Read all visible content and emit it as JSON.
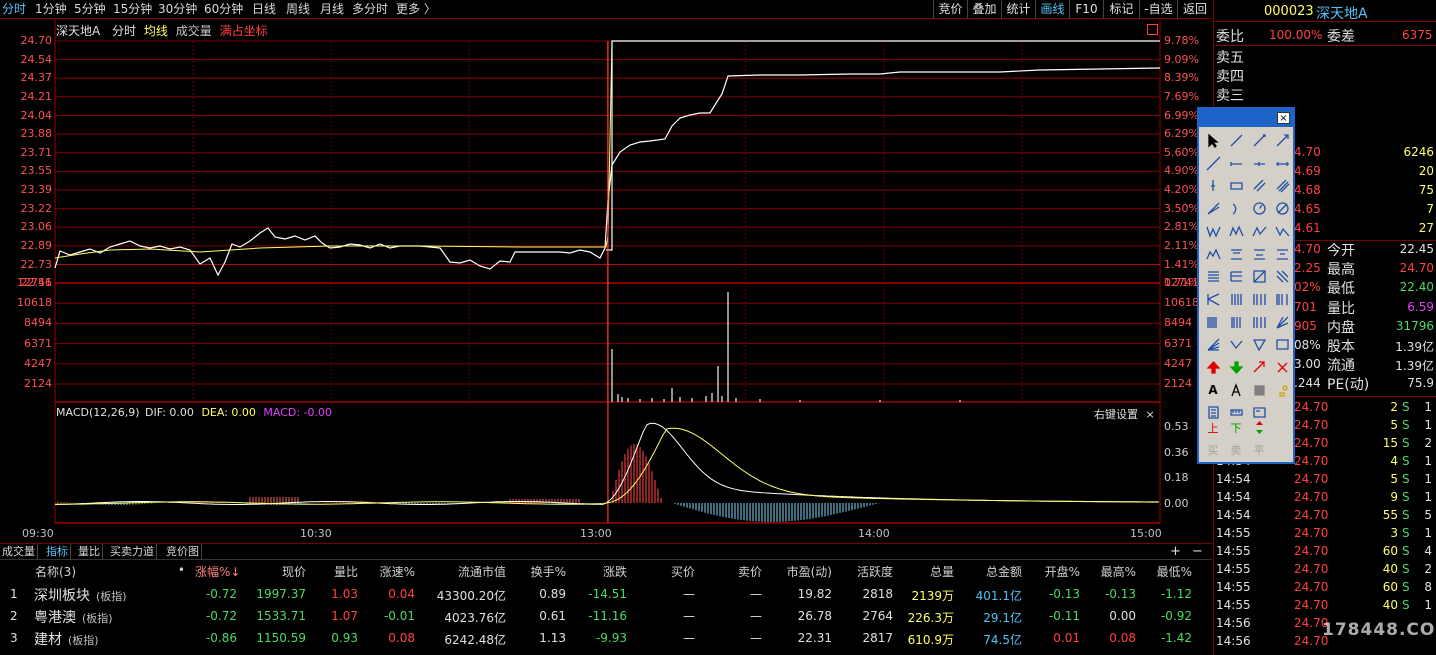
{
  "periods": [
    "分时",
    "1分钟",
    "5分钟",
    "15分钟",
    "30分钟",
    "60分钟",
    "日线",
    "周线",
    "月线",
    "多分时",
    "更多 〉"
  ],
  "active_period": 0,
  "right_buttons": [
    "竞价",
    "叠加",
    "统计",
    "画线",
    "F10",
    "标记",
    "-自选",
    "返回"
  ],
  "active_right_button": 3,
  "stock": {
    "code": "000023",
    "name": "深天地A"
  },
  "chart_info": {
    "name": "深天地A",
    "mode": "分时",
    "avg": "均线",
    "vol": "成交量",
    "fullscale": "满占坐标"
  },
  "price_axis": [
    "24.70",
    "24.54",
    "24.37",
    "24.21",
    "24.04",
    "23.88",
    "23.71",
    "23.55",
    "23.39",
    "23.22",
    "23.06",
    "22.89",
    "22.73",
    "22.56"
  ],
  "pct_axis": [
    "9.78%",
    "9.09%",
    "8.39%",
    "7.69%",
    "6.99%",
    "6.29%",
    "5.60%",
    "4.90%",
    "4.20%",
    "3.50%",
    "2.81%",
    "2.11%",
    "1.41%",
    "0.71%"
  ],
  "vol_axis": [
    "12741",
    "10618",
    "8494",
    "6371",
    "4247",
    "2124"
  ],
  "macd": {
    "label": "MACD(12,26,9)",
    "dif": "DIF: 0.00",
    "dea": "DEA: 0.00",
    "macd": "MACD: -0.00",
    "settings": "右键设置",
    "close": "×",
    "axis": [
      "0.53",
      "0.36",
      "0.18",
      "0.00"
    ]
  },
  "time_axis": [
    "09:30",
    "10:30",
    "13:00",
    "14:00",
    "15:00"
  ],
  "bottom_tabs": [
    "成交量",
    "指标",
    "量比",
    "买卖力道",
    "竞价图"
  ],
  "active_bottom_tab": 1,
  "bottom_controls": {
    "plus": "+",
    "minus": "−",
    "close": "×"
  },
  "table": {
    "headers": [
      "名称(3)",
      "•",
      "涨幅%↓",
      "现价",
      "量比",
      "涨速%",
      "流通市值",
      "换手%",
      "涨跌",
      "买价",
      "卖价",
      "市盈(动)",
      "活跃度",
      "总量",
      "总金额",
      "开盘%",
      "最高%",
      "最低%"
    ],
    "rows": [
      {
        "idx": "1",
        "name": "深圳板块",
        "tag": "(板指)",
        "chg": "-0.72",
        "price": "1997.37",
        "vr": "1.03",
        "speed": "0.04",
        "mcap": "43300.20亿",
        "turn": "0.89",
        "diff": "-14.51",
        "bid": "—",
        "ask": "—",
        "pe": "19.82",
        "act": "2818",
        "vol": "2139万",
        "amt": "401.1亿",
        "open": "-0.13",
        "high": "-0.13",
        "low": "-1.12"
      },
      {
        "idx": "2",
        "name": "粤港澳",
        "tag": "(板指)",
        "chg": "-0.72",
        "price": "1533.71",
        "vr": "1.07",
        "speed": "-0.01",
        "mcap": "4023.76亿",
        "turn": "0.61",
        "diff": "-11.16",
        "bid": "—",
        "ask": "—",
        "pe": "26.78",
        "act": "2764",
        "vol": "226.3万",
        "amt": "29.1亿",
        "open": "-0.11",
        "high": "0.00",
        "low": "-0.92"
      },
      {
        "idx": "3",
        "name": "建材",
        "tag": "(板指)",
        "chg": "-0.86",
        "price": "1150.59",
        "vr": "0.93",
        "speed": "0.08",
        "mcap": "6242.48亿",
        "turn": "1.13",
        "diff": "-9.93",
        "bid": "—",
        "ask": "—",
        "pe": "22.31",
        "act": "2817",
        "vol": "610.9万",
        "amt": "74.5亿",
        "open": "0.01",
        "high": "0.08",
        "low": "-1.42"
      }
    ]
  },
  "side": {
    "weibi_label": "委比",
    "weibi": "100.00%",
    "weicha_label": "委差",
    "weicha": "6375",
    "sells": [
      "卖五",
      "卖四",
      "卖三"
    ],
    "buys": [
      {
        "price": "4.70",
        "vol": "6246"
      },
      {
        "price": "4.69",
        "vol": "20"
      },
      {
        "price": "4.68",
        "vol": "75"
      },
      {
        "price": "4.65",
        "vol": "7"
      },
      {
        "price": "4.61",
        "vol": "27"
      }
    ],
    "stats": [
      {
        "left": "4.70",
        "label": "今开",
        "value": "22.45",
        "color": "#e0e0e0"
      },
      {
        "left": "2.25",
        "label": "最高",
        "value": "24.70",
        "color": "#ff4040"
      },
      {
        "left": "02%",
        "label": "最低",
        "value": "22.40",
        "color": "#4cd964"
      },
      {
        "left": "701",
        "label": "量比",
        "value": "6.59",
        "color": "#e040fb"
      },
      {
        "left": "905",
        "label": "内盘",
        "value": "31796",
        "color": "#4cd964"
      },
      {
        "left": "08%",
        "label": "股本",
        "value": "1.39亿",
        "color": "#e0e0e0"
      },
      {
        "left": "3.00",
        "label": "流通",
        "value": "1.39亿",
        "color": "#e0e0e0"
      },
      {
        "left": ".244",
        "label": "PE(动)",
        "value": "75.9",
        "color": "#e0e0e0"
      }
    ],
    "ticks": [
      {
        "time": "",
        "price": "24.70",
        "vol": "2",
        "bs": "S",
        "n": "1"
      },
      {
        "time": "",
        "price": "24.70",
        "vol": "5",
        "bs": "S",
        "n": "1"
      },
      {
        "time": "",
        "price": "24.70",
        "vol": "15",
        "bs": "S",
        "n": "2"
      },
      {
        "time": "14:54",
        "price": "24.70",
        "vol": "4",
        "bs": "S",
        "n": "1"
      },
      {
        "time": "14:54",
        "price": "24.70",
        "vol": "5",
        "bs": "S",
        "n": "1"
      },
      {
        "time": "14:54",
        "price": "24.70",
        "vol": "9",
        "bs": "S",
        "n": "1"
      },
      {
        "time": "14:54",
        "price": "24.70",
        "vol": "55",
        "bs": "S",
        "n": "5"
      },
      {
        "time": "14:55",
        "price": "24.70",
        "vol": "3",
        "bs": "S",
        "n": "1"
      },
      {
        "time": "14:55",
        "price": "24.70",
        "vol": "60",
        "bs": "S",
        "n": "4"
      },
      {
        "time": "14:55",
        "price": "24.70",
        "vol": "40",
        "bs": "S",
        "n": "2"
      },
      {
        "time": "14:55",
        "price": "24.70",
        "vol": "60",
        "bs": "S",
        "n": "8"
      },
      {
        "time": "14:55",
        "price": "24.70",
        "vol": "40",
        "bs": "S",
        "n": "1"
      },
      {
        "time": "14:56",
        "price": "24.70",
        "vol": "",
        "bs": "",
        "n": ""
      },
      {
        "time": "14:56",
        "price": "24.70",
        "vol": "",
        "bs": "",
        "n": ""
      }
    ]
  },
  "toolbox": {
    "close": "×",
    "text_tool": "A",
    "up": "上",
    "down": "下",
    "buy": "买",
    "sell": "卖",
    "flat": "平"
  },
  "watermark": "178448.COM"
}
